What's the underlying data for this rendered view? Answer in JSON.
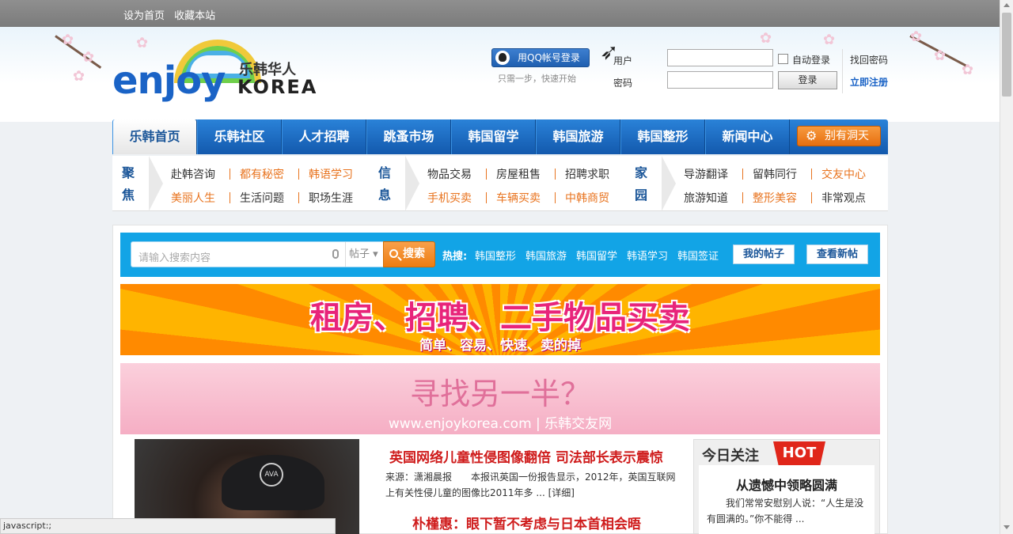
{
  "topbar": {
    "set_home": "设为首页",
    "bookmark": "收藏本站"
  },
  "logo": {
    "enjoy": "enjoy",
    "cn": "乐韩华人",
    "korea": "KOREA"
  },
  "login": {
    "qq_button": "用QQ帐号登录",
    "qq_hint": "只需一步，快速开始",
    "user_label": "用户",
    "password_label": "密码",
    "auto_login": "自动登录",
    "login_button": "登录",
    "find_password": "找回密码",
    "register": "立即注册"
  },
  "nav": {
    "items": [
      "乐韩首页",
      "乐韩社区",
      "人才招聘",
      "跳蚤市场",
      "韩国留学",
      "韩国旅游",
      "韩国整形",
      "新闻中心"
    ],
    "special": "别有洞天"
  },
  "subnav": {
    "groups": [
      {
        "title1": "聚",
        "title2": "焦",
        "row1": [
          "赴韩咨询",
          "都有秘密",
          "韩语学习"
        ],
        "row2": [
          "美丽人生",
          "生活问题",
          "职场生涯"
        ]
      },
      {
        "title1": "信",
        "title2": "息",
        "row1": [
          "物品交易",
          "房屋租售",
          "招聘求职"
        ],
        "row2": [
          "手机买卖",
          "车辆买卖",
          "中韩商贸"
        ]
      },
      {
        "title1": "家",
        "title2": "园",
        "row1": [
          "导游翻译",
          "留韩同行",
          "交友中心"
        ],
        "row2": [
          "旅游知道",
          "整形美容",
          "非常观点"
        ]
      }
    ]
  },
  "search": {
    "placeholder": "请输入搜索内容",
    "scope": "帖子",
    "button": "搜索",
    "hot_label": "热搜:",
    "hot_links": [
      "韩国整形",
      "韩国旅游",
      "韩国留学",
      "韩语学习",
      "韩国签证"
    ],
    "my_posts": "我的帖子",
    "new_posts": "查看新帖"
  },
  "banners": {
    "b1_title": "租房、招聘、二手物品买卖",
    "b1_sub": "简单、容易、快速、卖的掉",
    "b2_title": "寻找另一半？",
    "b2_sub": "www.enjoykorea.com | 乐韩交友网"
  },
  "news": {
    "headline1": "英国网络儿童性侵图像翻倍 司法部长表示震惊",
    "meta1": "来源：潇湘晨报　　本报讯英国一份报告显示，2012年，英国互联网上有关性侵儿童的图像比2011年多 ... [详细]",
    "headline2": "朴槿惠：眼下暂不考虑与日本首相会晤"
  },
  "today": {
    "title": "今日关注",
    "hot": "HOT",
    "headline": "从遗憾中领略圆满",
    "text": "我们常常安慰别人说：“人生是没有圆满的。”你不能得 ..."
  },
  "status": {
    "text": "javascript:;"
  },
  "colors": {
    "nav_blue": "#1359ad",
    "accent_orange": "#ed7d12",
    "search_blue": "#12a4e6",
    "headline_red": "#cf1c1c"
  }
}
